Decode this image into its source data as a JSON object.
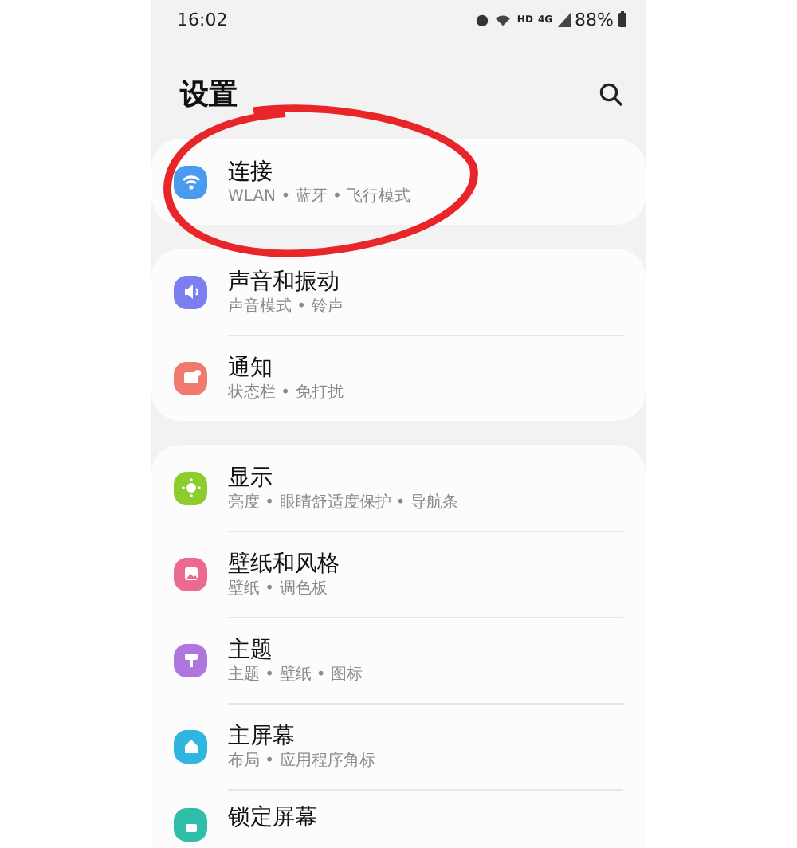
{
  "status_bar": {
    "time": "16:02",
    "hd": "HD",
    "network": "4G",
    "battery": "88%"
  },
  "header": {
    "title": "设置"
  },
  "groups": [
    {
      "items": [
        {
          "title": "连接",
          "subtitle": "WLAN • 蓝牙 • 飞行模式",
          "kind": "wifi",
          "color": "#4a9af0"
        }
      ]
    },
    {
      "items": [
        {
          "title": "声音和振动",
          "subtitle": "声音模式 • 铃声",
          "kind": "sound",
          "color": "#7d7ef0"
        },
        {
          "title": "通知",
          "subtitle": "状态栏 • 免打扰",
          "kind": "notify",
          "color": "#f07a6e"
        }
      ]
    },
    {
      "items": [
        {
          "title": "显示",
          "subtitle": "亮度 • 眼睛舒适度保护 • 导航条",
          "kind": "display",
          "color": "#8ccc2c"
        },
        {
          "title": "壁纸和风格",
          "subtitle": "壁纸 • 调色板",
          "kind": "wallpaper",
          "color": "#ec6a8e"
        },
        {
          "title": "主题",
          "subtitle": "主题 • 壁纸 • 图标",
          "kind": "theme",
          "color": "#b076e0"
        },
        {
          "title": "主屏幕",
          "subtitle": "布局 • 应用程序角标",
          "kind": "home",
          "color": "#2fb6e0"
        },
        {
          "title": "锁定屏幕",
          "kind": "lock",
          "color": "#2fbfa8"
        }
      ]
    }
  ]
}
